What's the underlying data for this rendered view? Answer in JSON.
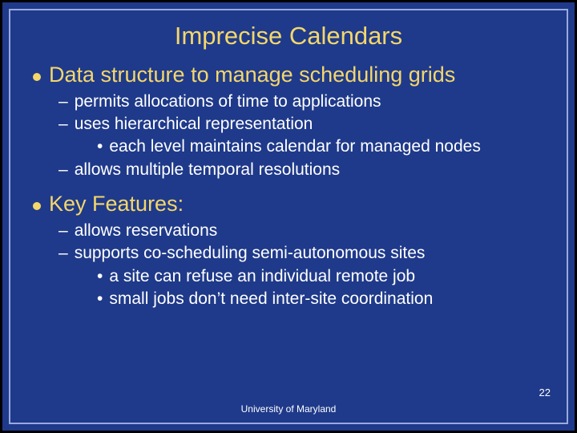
{
  "title": "Imprecise Calendars",
  "sections": [
    {
      "heading": "Data structure to manage scheduling grids",
      "subs": [
        {
          "text": "permits allocations of time to applications",
          "subsubs": []
        },
        {
          "text": "uses hierarchical representation",
          "subsubs": [
            "each level maintains calendar for managed nodes"
          ]
        },
        {
          "text": "allows multiple temporal resolutions",
          "subsubs": []
        }
      ]
    },
    {
      "heading": "Key Features:",
      "subs": [
        {
          "text": "allows reservations",
          "subsubs": []
        },
        {
          "text": "supports co-scheduling semi-autonomous sites",
          "subsubs": [
            "a site can refuse an individual  remote job",
            "small jobs don’t need inter-site coordination"
          ]
        }
      ]
    }
  ],
  "footer": "University of Maryland",
  "page_number": "22"
}
